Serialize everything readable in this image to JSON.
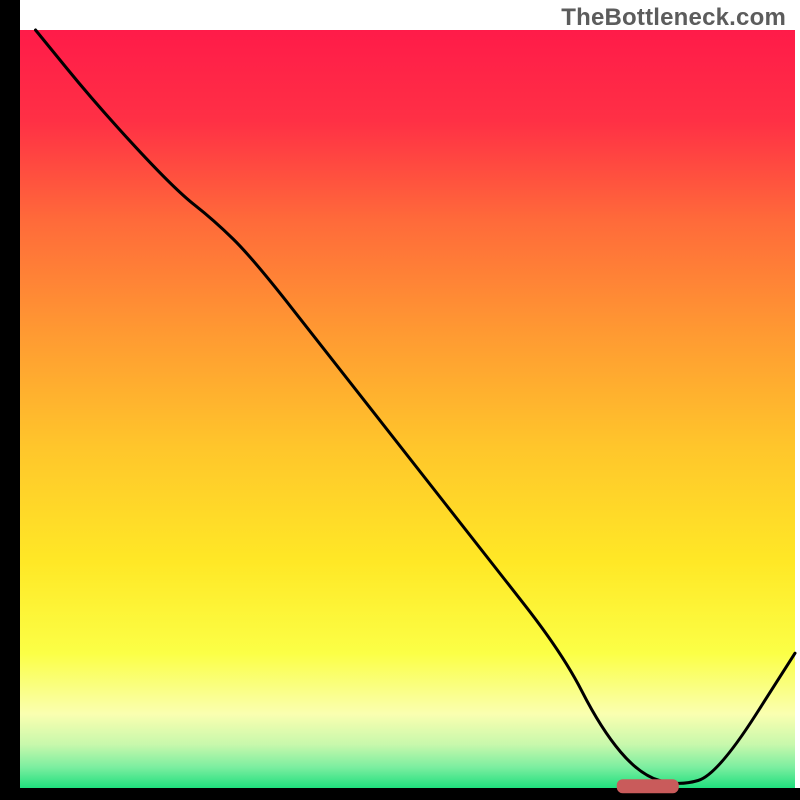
{
  "watermark": "TheBottleneck.com",
  "chart_data": {
    "type": "line",
    "title": "",
    "xlabel": "",
    "ylabel": "",
    "xlim": [
      0,
      100
    ],
    "ylim": [
      0,
      100
    ],
    "grid": false,
    "legend": false,
    "series": [
      {
        "name": "curve",
        "x": [
          2,
          10,
          20,
          25,
          30,
          40,
          50,
          60,
          70,
          75,
          80,
          85,
          90,
          100
        ],
        "values": [
          100,
          90,
          79,
          75,
          70,
          57,
          44,
          31,
          18,
          8,
          2,
          0.5,
          2,
          18
        ]
      }
    ],
    "marker": {
      "x_start": 77,
      "x_end": 85,
      "y": 0.5,
      "color": "#c95b5b"
    },
    "gradient_stops": [
      {
        "offset": 0.0,
        "color": "#ff1b49"
      },
      {
        "offset": 0.12,
        "color": "#ff3045"
      },
      {
        "offset": 0.25,
        "color": "#ff6a3a"
      },
      {
        "offset": 0.4,
        "color": "#ff9a32"
      },
      {
        "offset": 0.55,
        "color": "#ffc62b"
      },
      {
        "offset": 0.7,
        "color": "#ffe826"
      },
      {
        "offset": 0.82,
        "color": "#fbff46"
      },
      {
        "offset": 0.9,
        "color": "#faffb0"
      },
      {
        "offset": 0.94,
        "color": "#c8f8ac"
      },
      {
        "offset": 0.97,
        "color": "#7ceea0"
      },
      {
        "offset": 1.0,
        "color": "#17de7a"
      }
    ]
  }
}
